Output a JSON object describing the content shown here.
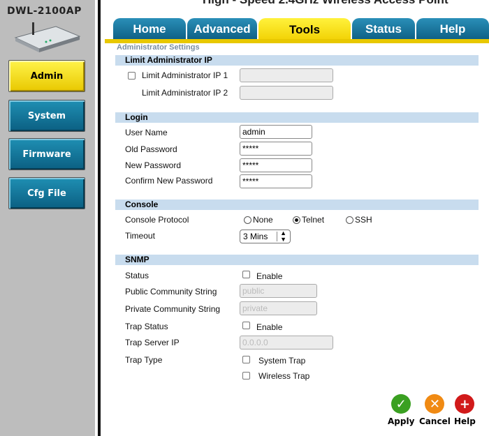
{
  "banner": {
    "title": "High - Speed 2.4GHz Wireless Access Point"
  },
  "model": "DWL-2100AP",
  "sidebar": {
    "items": [
      {
        "label": "Admin",
        "active": true
      },
      {
        "label": "System",
        "active": false
      },
      {
        "label": "Firmware",
        "active": false
      },
      {
        "label": "Cfg File",
        "active": false
      }
    ]
  },
  "tabs": [
    {
      "label": "Home",
      "active": false
    },
    {
      "label": "Advanced",
      "active": false
    },
    {
      "label": "Tools",
      "active": true
    },
    {
      "label": "Status",
      "active": false
    },
    {
      "label": "Help",
      "active": false
    }
  ],
  "breadcrumb": "Administrator Settings",
  "limit_ip": {
    "header": "Limit Administrator IP",
    "ip1_label": "Limit Administrator IP 1",
    "ip1_value": "",
    "ip1_checked": false,
    "ip2_label": "Limit Administrator IP 2",
    "ip2_value": ""
  },
  "login": {
    "header": "Login",
    "username_label": "User Name",
    "username_value": "admin",
    "old_pw_label": "Old Password",
    "old_pw_value": "*****",
    "new_pw_label": "New Password",
    "new_pw_value": "*****",
    "confirm_pw_label": "Confirm New Password",
    "confirm_pw_value": "*****"
  },
  "console": {
    "header": "Console",
    "protocol_label": "Console Protocol",
    "options": [
      "None",
      "Telnet",
      "SSH"
    ],
    "selected": "Telnet",
    "timeout_label": "Timeout",
    "timeout_value": "3 Mins"
  },
  "snmp": {
    "header": "SNMP",
    "status_label": "Status",
    "enable_label": "Enable",
    "status_enabled": false,
    "public_label": "Public Community String",
    "public_value": "public",
    "private_label": "Private Community String",
    "private_value": "private",
    "trap_status_label": "Trap Status",
    "trap_enable_label": "Enable",
    "trap_server_label": "Trap Server IP",
    "trap_server_value": "0.0.0.0",
    "trap_type_label": "Trap Type",
    "system_trap_label": "System Trap",
    "wireless_trap_label": "Wireless Trap"
  },
  "actions": {
    "apply": "Apply",
    "cancel": "Cancel",
    "help": "Help"
  },
  "colors": {
    "tab_blue": "#1a7aa3",
    "active_yellow": "#f5dc10",
    "section_bg": "#c8dcee",
    "apply_green": "#3aa021",
    "cancel_orange": "#f08a13",
    "help_red": "#d11a1a"
  }
}
